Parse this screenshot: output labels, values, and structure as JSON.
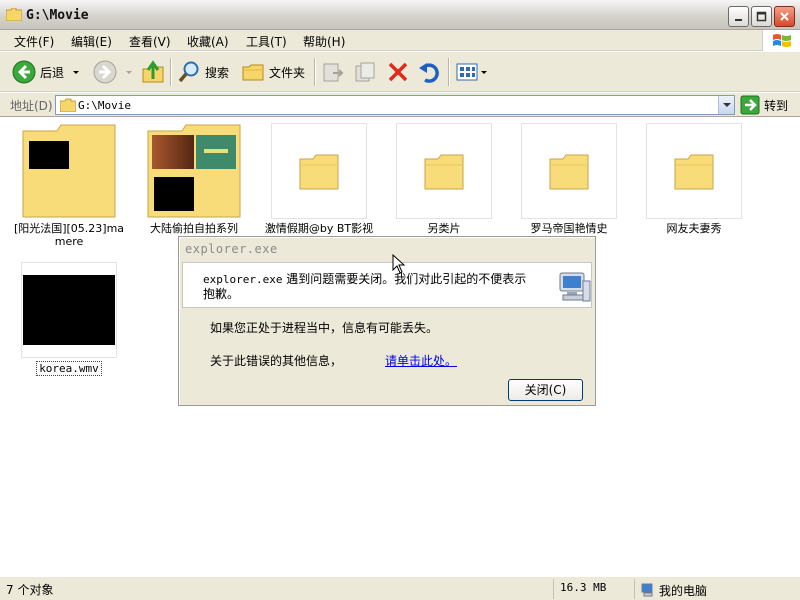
{
  "window": {
    "title": "G:\\Movie"
  },
  "menu": [
    "文件(F)",
    "编辑(E)",
    "查看(V)",
    "收藏(A)",
    "工具(T)",
    "帮助(H)"
  ],
  "toolbar": {
    "back_label": "后退",
    "search_label": "搜索",
    "folders_label": "文件夹"
  },
  "address": {
    "label": "地址(D)",
    "value": "G:\\Movie",
    "go_label": "转到"
  },
  "files": [
    {
      "name": "[阳光法国][05.23]mamere"
    },
    {
      "name": "大陆偷拍自拍系列"
    },
    {
      "name": "激情假期@by BT影视天"
    },
    {
      "name": "另类片"
    },
    {
      "name": "罗马帝国艳情史"
    },
    {
      "name": "网友夫妻秀"
    },
    {
      "name": "korea.wmv"
    }
  ],
  "dialog": {
    "title": "explorer.exe",
    "message_exe": "explorer.exe",
    "message_text": " 遇到问题需要关闭。我们对此引起的不便表示抱歉。",
    "line1": "如果您正处于进程当中，信息有可能丢失。",
    "line2": "关于此错误的其他信息，",
    "link": "请单击此处。",
    "close_button": "关闭(C)"
  },
  "status": {
    "objects": "7 个对象",
    "size": "16.3 MB",
    "location": "我的电脑"
  },
  "colors": {
    "accent": "#0054e3",
    "link": "#0000ee",
    "folder": "#f7d774"
  }
}
